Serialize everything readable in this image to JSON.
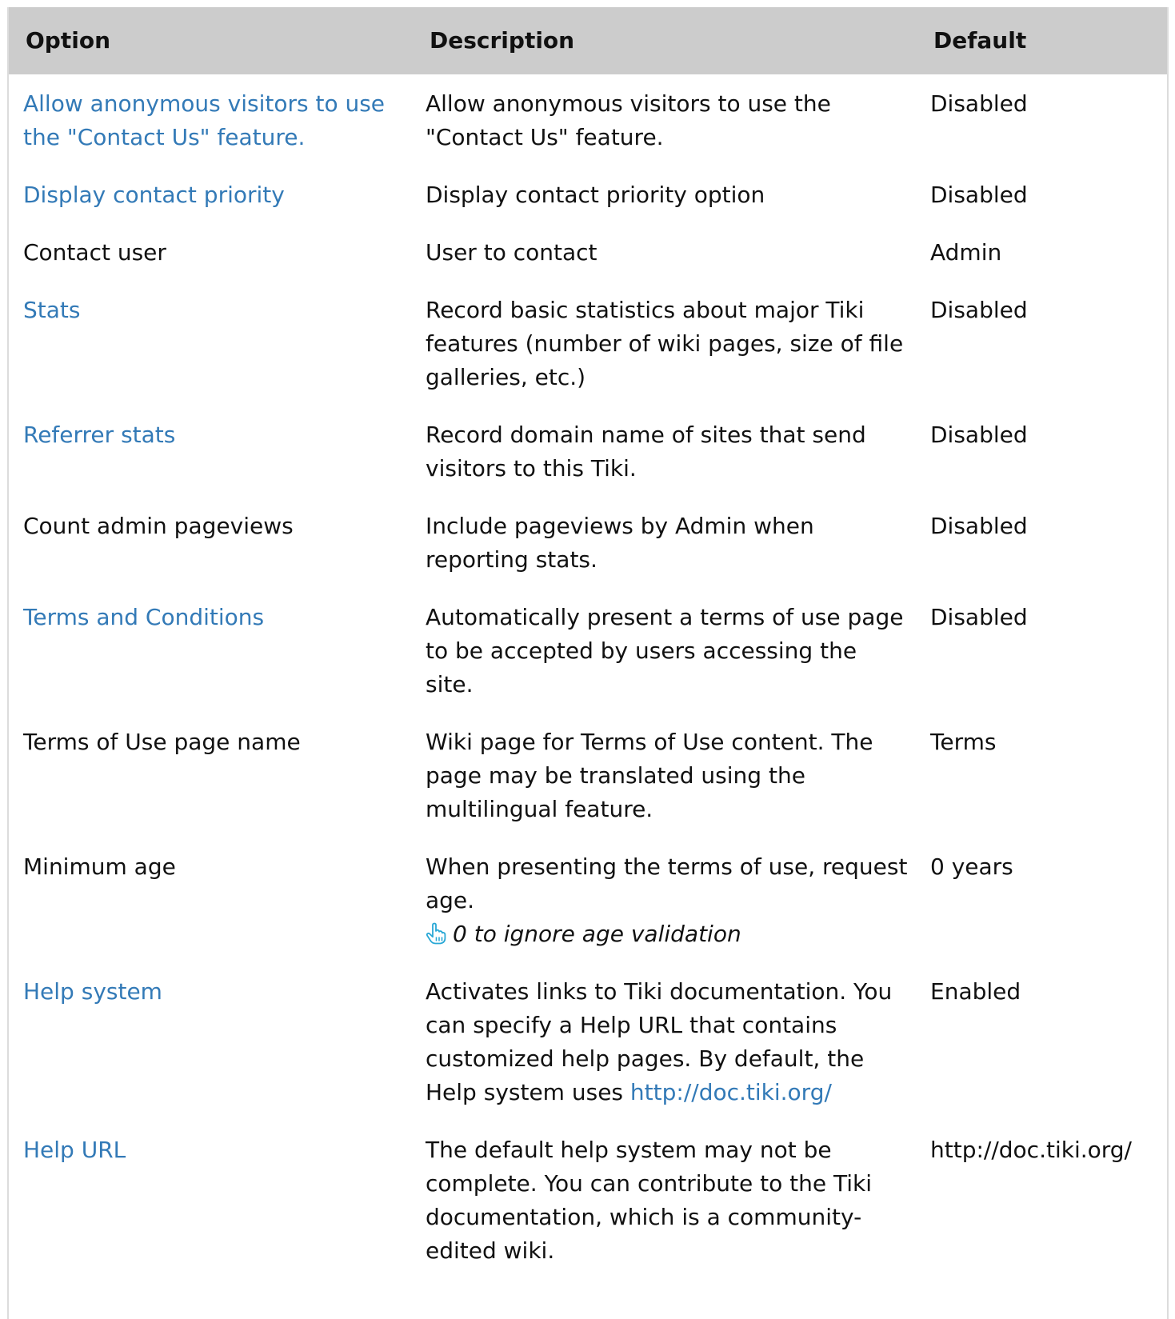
{
  "header": {
    "option": "Option",
    "description": "Description",
    "default": "Default"
  },
  "rows": [
    {
      "option": "Allow anonymous visitors to use the \"Contact Us\" feature.",
      "option_is_link": true,
      "description": "Allow anonymous visitors to use the \"Contact Us\" feature.",
      "default": "Disabled"
    },
    {
      "option": "Display contact priority",
      "option_is_link": true,
      "description": "Display contact priority option",
      "default": "Disabled"
    },
    {
      "option": "Contact user",
      "option_is_link": false,
      "description": "User to contact",
      "default": "Admin"
    },
    {
      "option": "Stats",
      "option_is_link": true,
      "description": "Record basic statistics about major Tiki features (number of wiki pages, size of file galleries, etc.)",
      "default": "Disabled"
    },
    {
      "option": "Referrer stats",
      "option_is_link": true,
      "description": "Record domain name of sites that send visitors to this Tiki.",
      "default": "Disabled"
    },
    {
      "option": "Count admin pageviews",
      "option_is_link": false,
      "description": "Include pageviews by Admin when reporting stats.",
      "default": "Disabled"
    },
    {
      "option": "Terms and Conditions",
      "option_is_link": true,
      "description": "Automatically present a terms of use page to be accepted by users accessing the site.",
      "default": "Disabled"
    },
    {
      "option": "Terms of Use page name",
      "option_is_link": false,
      "description": "Wiki page for Terms of Use content. The page may be translated using the multilingual feature.",
      "default": "Terms"
    },
    {
      "option": "Minimum age",
      "option_is_link": false,
      "description": "When presenting the terms of use, request age.",
      "hint_icon": "hand-pointer-icon",
      "hint": "0 to ignore age validation",
      "default": "0 years"
    },
    {
      "option": "Help system",
      "option_is_link": true,
      "description": "Activates links to Tiki documentation. You can specify a Help URL that contains customized help pages. By default, the Help system uses ",
      "description_link": "http://doc.tiki.org/",
      "default": "Enabled"
    },
    {
      "option": "Help URL",
      "option_is_link": true,
      "description": "The default help system may not be complete. You can contribute to the Tiki documentation, which is a community-edited wiki.",
      "default": "http://doc.tiki.org/"
    }
  ],
  "colors": {
    "header_bg": "#cccccc",
    "link": "#337ab7",
    "hint_icon": "#29a8d6",
    "text": "#111111"
  }
}
